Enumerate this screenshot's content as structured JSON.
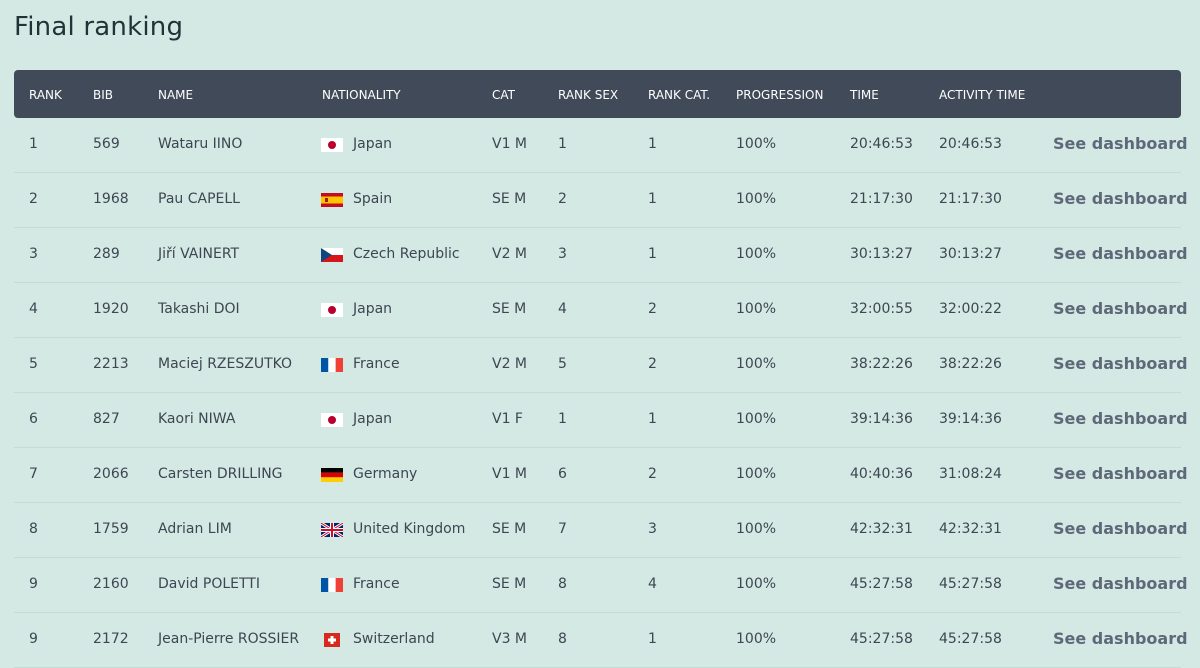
{
  "page": {
    "title": "Final ranking"
  },
  "table": {
    "headers": [
      "RANK",
      "BIB",
      "NAME",
      "NATIONALITY",
      "CAT",
      "RANK SEX",
      "RANK CAT.",
      "PROGRESSION",
      "TIME",
      "ACTIVITY TIME"
    ],
    "link_label": "See dashboard",
    "rows": [
      {
        "rank": "1",
        "bib": "569",
        "name": "Wataru IINO",
        "flag": "japan-flag-icon",
        "nationality": "Japan",
        "cat": "V1 M",
        "rank_sex": "1",
        "rank_cat": "1",
        "progression": "100%",
        "time": "20:46:53",
        "activity_time": "20:46:53"
      },
      {
        "rank": "2",
        "bib": "1968",
        "name": "Pau CAPELL",
        "flag": "spain-flag-icon",
        "nationality": "Spain",
        "cat": "SE M",
        "rank_sex": "2",
        "rank_cat": "1",
        "progression": "100%",
        "time": "21:17:30",
        "activity_time": "21:17:30"
      },
      {
        "rank": "3",
        "bib": "289",
        "name": "Jiří VAINERT",
        "flag": "czech-flag-icon",
        "nationality": "Czech Republic",
        "cat": "V2 M",
        "rank_sex": "3",
        "rank_cat": "1",
        "progression": "100%",
        "time": "30:13:27",
        "activity_time": "30:13:27"
      },
      {
        "rank": "4",
        "bib": "1920",
        "name": "Takashi DOI",
        "flag": "japan-flag-icon",
        "nationality": "Japan",
        "cat": "SE M",
        "rank_sex": "4",
        "rank_cat": "2",
        "progression": "100%",
        "time": "32:00:55",
        "activity_time": "32:00:22"
      },
      {
        "rank": "5",
        "bib": "2213",
        "name": "Maciej RZESZUTKO",
        "flag": "france-flag-icon",
        "nationality": "France",
        "cat": "V2 M",
        "rank_sex": "5",
        "rank_cat": "2",
        "progression": "100%",
        "time": "38:22:26",
        "activity_time": "38:22:26"
      },
      {
        "rank": "6",
        "bib": "827",
        "name": "Kaori NIWA",
        "flag": "japan-flag-icon",
        "nationality": "Japan",
        "cat": "V1 F",
        "rank_sex": "1",
        "rank_cat": "1",
        "progression": "100%",
        "time": "39:14:36",
        "activity_time": "39:14:36"
      },
      {
        "rank": "7",
        "bib": "2066",
        "name": "Carsten DRILLING",
        "flag": "germany-flag-icon",
        "nationality": "Germany",
        "cat": "V1 M",
        "rank_sex": "6",
        "rank_cat": "2",
        "progression": "100%",
        "time": "40:40:36",
        "activity_time": "31:08:24"
      },
      {
        "rank": "8",
        "bib": "1759",
        "name": "Adrian LIM",
        "flag": "uk-flag-icon",
        "nationality": "United Kingdom",
        "cat": "SE M",
        "rank_sex": "7",
        "rank_cat": "3",
        "progression": "100%",
        "time": "42:32:31",
        "activity_time": "42:32:31"
      },
      {
        "rank": "9",
        "bib": "2160",
        "name": "David POLETTI",
        "flag": "france-flag-icon",
        "nationality": "France",
        "cat": "SE M",
        "rank_sex": "8",
        "rank_cat": "4",
        "progression": "100%",
        "time": "45:27:58",
        "activity_time": "45:27:58"
      },
      {
        "rank": "9",
        "bib": "2172",
        "name": "Jean-Pierre ROSSIER",
        "flag": "switzerland-flag-icon",
        "nationality": "Switzerland",
        "cat": "V3 M",
        "rank_sex": "8",
        "rank_cat": "1",
        "progression": "100%",
        "time": "45:27:58",
        "activity_time": "45:27:58"
      }
    ]
  },
  "colors": {
    "background": "#d5e9e4",
    "header": "#414a58",
    "link": "#5e6878"
  }
}
